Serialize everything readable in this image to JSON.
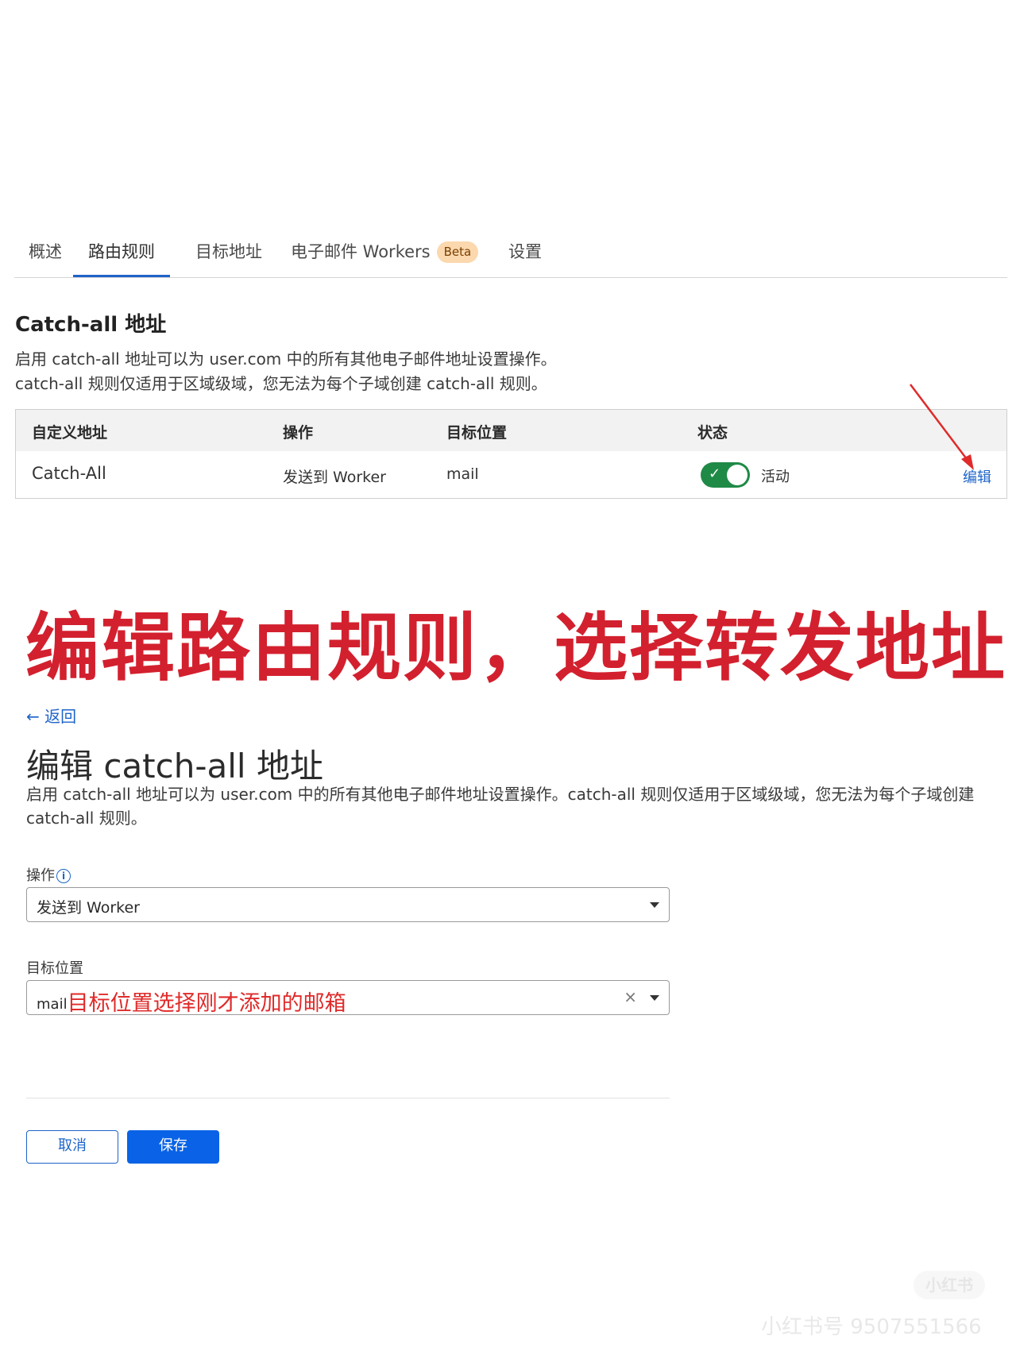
{
  "tabs": [
    {
      "label": "概述"
    },
    {
      "label": "路由规则",
      "active": true
    },
    {
      "label": "目标地址"
    },
    {
      "label": "电子邮件 Workers",
      "badge": "Beta"
    },
    {
      "label": "设置"
    }
  ],
  "catch_all": {
    "title": "Catch-all 地址",
    "desc_line1": "启用 catch-all 地址可以为 user.com 中的所有其他电子邮件地址设置操作。",
    "desc_line2": "catch-all 规则仅适用于区域级域，您无法为每个子域创建 catch-all 规则。",
    "table": {
      "headers": [
        "自定义地址",
        "操作",
        "目标位置",
        "状态"
      ],
      "row": {
        "address": "Catch-All",
        "action": "发送到 Worker",
        "destination": "mail",
        "status": "活动",
        "enabled": true,
        "edit_label": "编辑"
      }
    }
  },
  "annotation_heading": "编辑路由规则，选择转发地址",
  "edit_form": {
    "back_label": "返回",
    "title": "编辑 catch-all 地址",
    "description": "启用 catch-all 地址可以为 user.com 中的所有其他电子邮件地址设置操作。catch-all 规则仅适用于区域级域，您无法为每个子域创建 catch-all 规则。",
    "action_label": "操作",
    "action_value": "发送到 Worker",
    "destination_label": "目标位置",
    "destination_value": "mail",
    "destination_annotation": "目标位置选择刚才添加的邮箱",
    "cancel_label": "取消",
    "save_label": "保存"
  },
  "watermark": {
    "logo": "小红书",
    "id_text": "小红书号 9507551566"
  },
  "colors": {
    "accent": "#1e64c8",
    "toggle_on": "#1f8a46",
    "annotation_red": "#d3202e",
    "save_button": "#0a63e6"
  }
}
